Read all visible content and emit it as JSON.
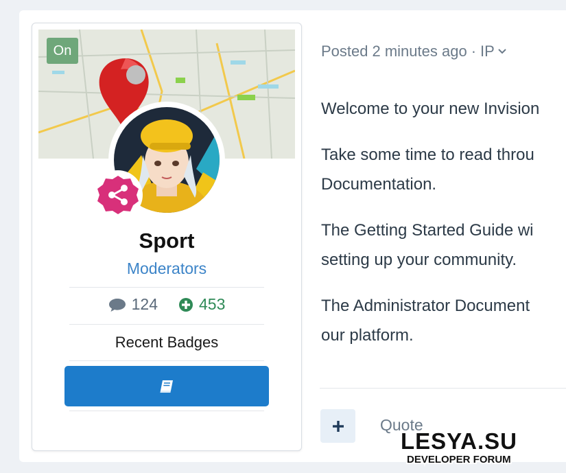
{
  "author": {
    "online_label": "On",
    "username": "Sport",
    "group": "Moderators",
    "stats": {
      "posts": "124",
      "reputation": "453"
    },
    "badges_heading": "Recent Badges"
  },
  "post": {
    "meta_prefix": "Posted",
    "meta_time": "2 minutes ago",
    "meta_separator": "·",
    "meta_ip": "IP",
    "paragraphs": [
      "Welcome to your new Invision",
      "Take some time to read throu",
      "Documentation.",
      "The Getting Started Guide wi",
      "setting up your community.",
      "The Administrator Document",
      "our platform."
    ],
    "quote_label": "Quote"
  },
  "watermark": {
    "title": "LESYA.SU",
    "subtitle": "DEVELOPER FORUM"
  },
  "colors": {
    "accent": "#1d7ccb",
    "online": "#6fa77a",
    "link": "#3c84c8",
    "reputation": "#2f8a57",
    "group_badge": "#d8307a"
  },
  "icons": [
    "map-pin-icon",
    "share-icon",
    "comment-icon",
    "plus-circle-icon",
    "book-icon",
    "chevron-down-icon",
    "plus-icon"
  ]
}
